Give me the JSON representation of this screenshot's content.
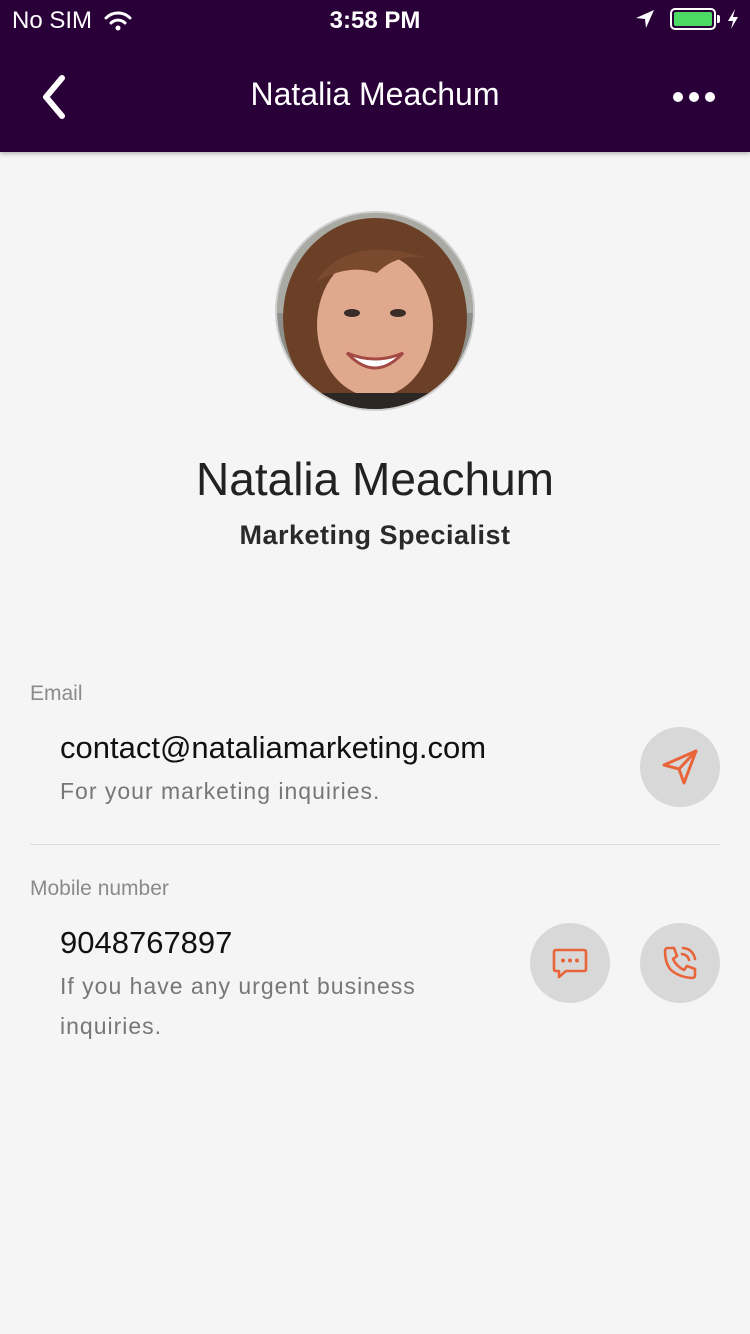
{
  "status_bar": {
    "carrier": "No SIM",
    "time": "3:58 PM",
    "battery_color": "#4cd964"
  },
  "nav": {
    "title": "Natalia Meachum",
    "back_icon": "chevron-left-icon",
    "more_icon": "more-horizontal-icon",
    "background": "#2a0038"
  },
  "profile": {
    "name": "Natalia Meachum",
    "role": "Marketing Specialist"
  },
  "email_section": {
    "label": "Email",
    "value": "contact@nataliamarketing.com",
    "description": "For your marketing inquiries.",
    "action_icon": "send-icon"
  },
  "mobile_section": {
    "label": "Mobile number",
    "value": "9048767897",
    "description": "If you have any urgent business inquiries.",
    "message_icon": "message-icon",
    "call_icon": "phone-call-icon"
  },
  "accent_color": "#e8653a"
}
